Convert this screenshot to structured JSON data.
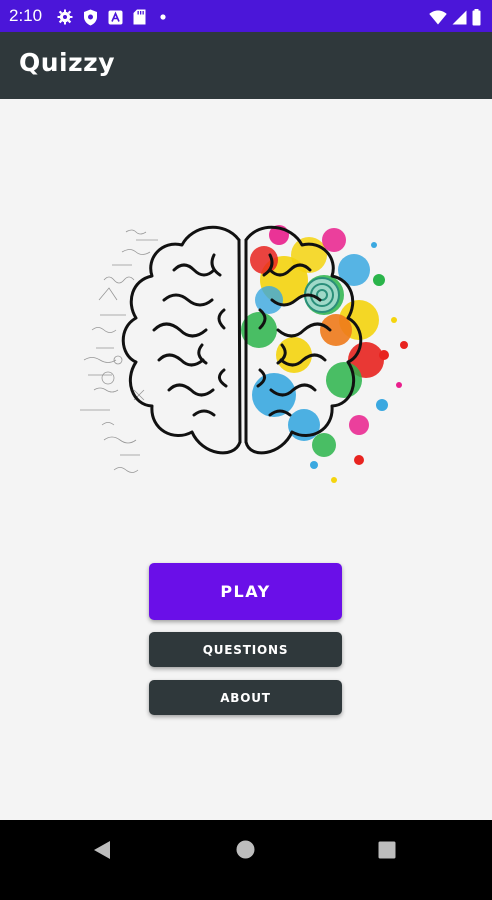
{
  "status_bar": {
    "time": "2:10",
    "left_icons": [
      "gear-icon",
      "shield-icon",
      "a-box-icon",
      "sd-card-icon",
      "dot-icon"
    ],
    "right_icons": [
      "wifi-icon",
      "signal-icon",
      "battery-icon"
    ],
    "color": "#4b16d9"
  },
  "app_bar": {
    "title": "Quizzy",
    "color": "#2f383b"
  },
  "hero_image": {
    "description_icon": "brain-illustration"
  },
  "buttons": {
    "play_label": "PLAY",
    "questions_label": "QUESTIONS",
    "about_label": "ABOUT",
    "play_color": "#6a0fe8",
    "secondary_color": "#2f383b"
  },
  "nav_bar": {
    "icons": [
      "back-icon",
      "home-icon",
      "recents-icon"
    ]
  }
}
